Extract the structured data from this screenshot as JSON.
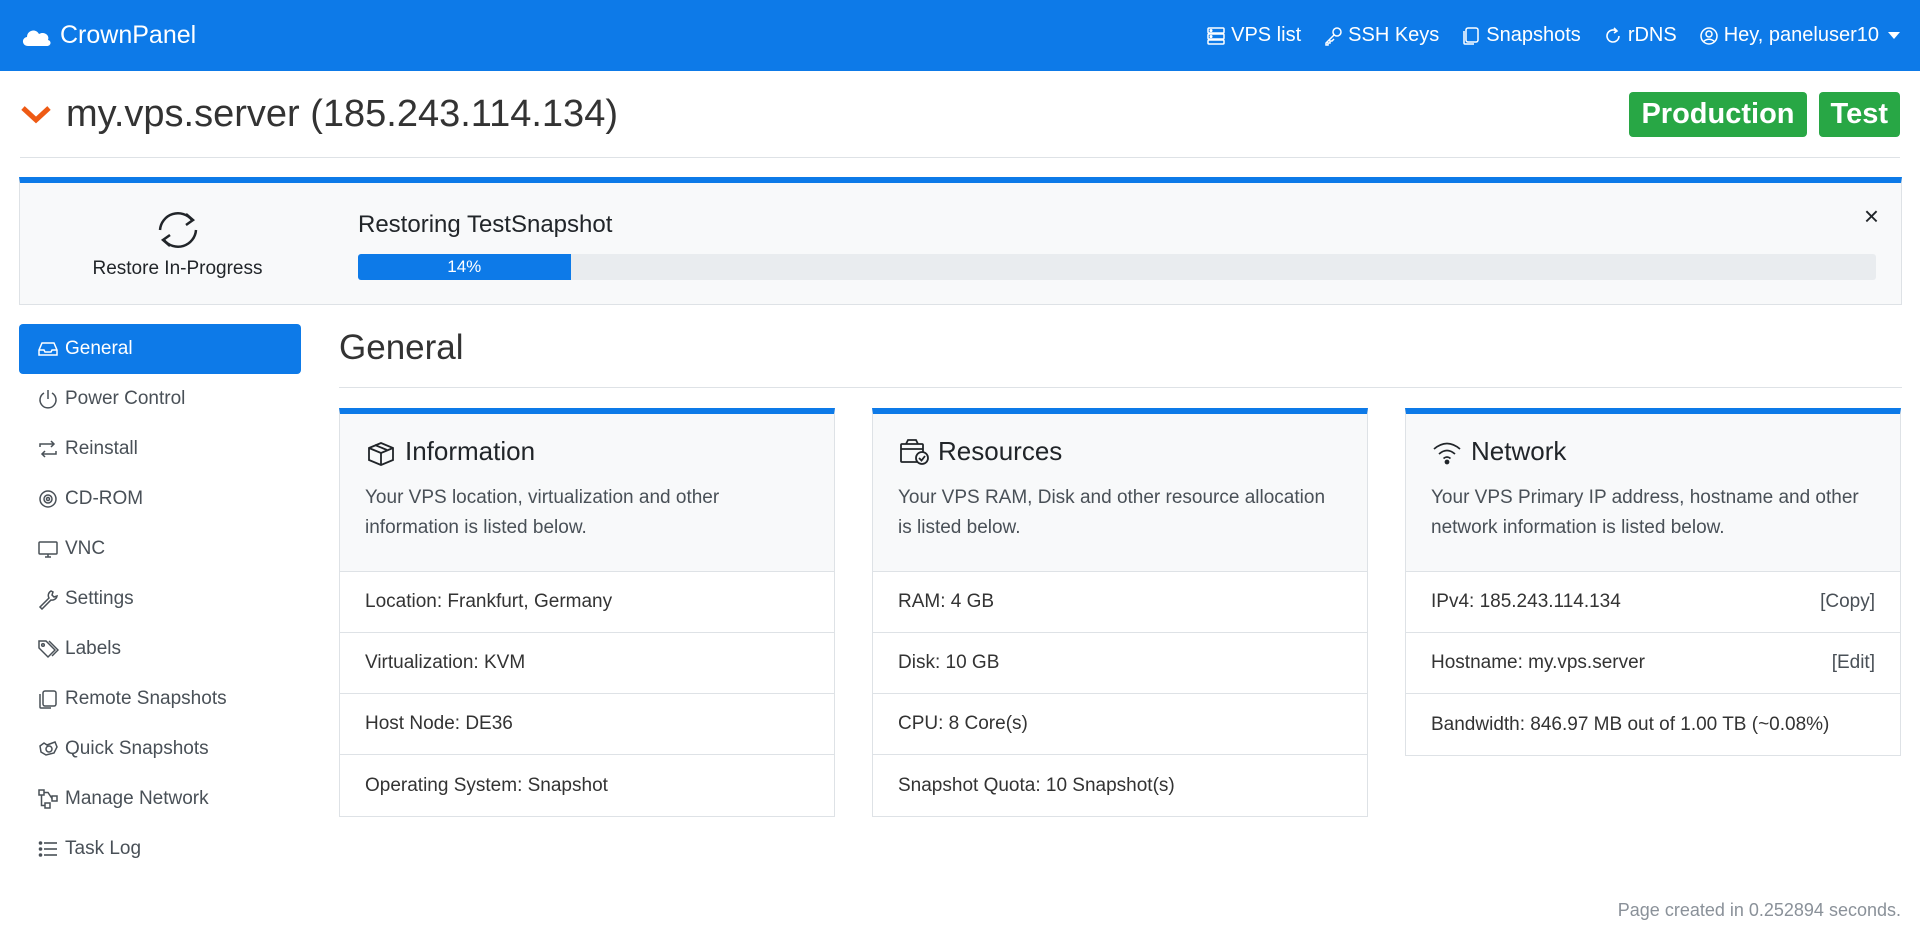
{
  "navbar": {
    "brand": "CrownPanel",
    "items": [
      {
        "label": "VPS list",
        "icon": "server-icon"
      },
      {
        "label": "SSH Keys",
        "icon": "key-icon"
      },
      {
        "label": "Snapshots",
        "icon": "copy-icon"
      },
      {
        "label": "rDNS",
        "icon": "refresh-icon"
      }
    ],
    "user_label": "Hey, paneluser10"
  },
  "server": {
    "title": "my.vps.server (185.243.114.134)",
    "badges": [
      "Production",
      "Test"
    ]
  },
  "restore": {
    "status": "Restore In-Progress",
    "title": "Restoring TestSnapshot",
    "progress": 14,
    "progress_label": "14%",
    "close": "×"
  },
  "sidebar": {
    "items": [
      {
        "label": "General",
        "active": true
      },
      {
        "label": "Power Control"
      },
      {
        "label": "Reinstall"
      },
      {
        "label": "CD-ROM"
      },
      {
        "label": "VNC"
      },
      {
        "label": "Settings"
      },
      {
        "label": "Labels"
      },
      {
        "label": "Remote Snapshots"
      },
      {
        "label": "Quick Snapshots"
      },
      {
        "label": "Manage Network"
      },
      {
        "label": "Task Log"
      }
    ]
  },
  "main": {
    "title": "General",
    "cards": [
      {
        "title": "Information",
        "desc": "Your VPS location, virtualization and other information is listed below.",
        "rows": [
          {
            "text": "Location: Frankfurt, Germany"
          },
          {
            "text": "Virtualization: KVM"
          },
          {
            "text": "Host Node: DE36"
          },
          {
            "text": "Operating System: Snapshot"
          }
        ]
      },
      {
        "title": "Resources",
        "desc": "Your VPS RAM, Disk and other resource allocation is listed below.",
        "rows": [
          {
            "text": "RAM: 4 GB"
          },
          {
            "text": "Disk: 10 GB"
          },
          {
            "text": "CPU: 8 Core(s)"
          },
          {
            "text": "Snapshot Quota: 10 Snapshot(s)"
          }
        ]
      },
      {
        "title": "Network",
        "desc": "Your VPS Primary IP address, hostname and other network information is listed below.",
        "rows": [
          {
            "text": "IPv4: 185.243.114.134",
            "action": "[Copy]"
          },
          {
            "text": "Hostname: my.vps.server",
            "action": "[Edit]"
          },
          {
            "text": "Bandwidth: 846.97 MB out of 1.00 TB (~0.08%)"
          }
        ]
      }
    ]
  },
  "footer": "Page created in 0.252894 seconds.",
  "colors": {
    "primary": "#0d7ae8",
    "success": "#28a745",
    "accent": "#ee5a14"
  }
}
